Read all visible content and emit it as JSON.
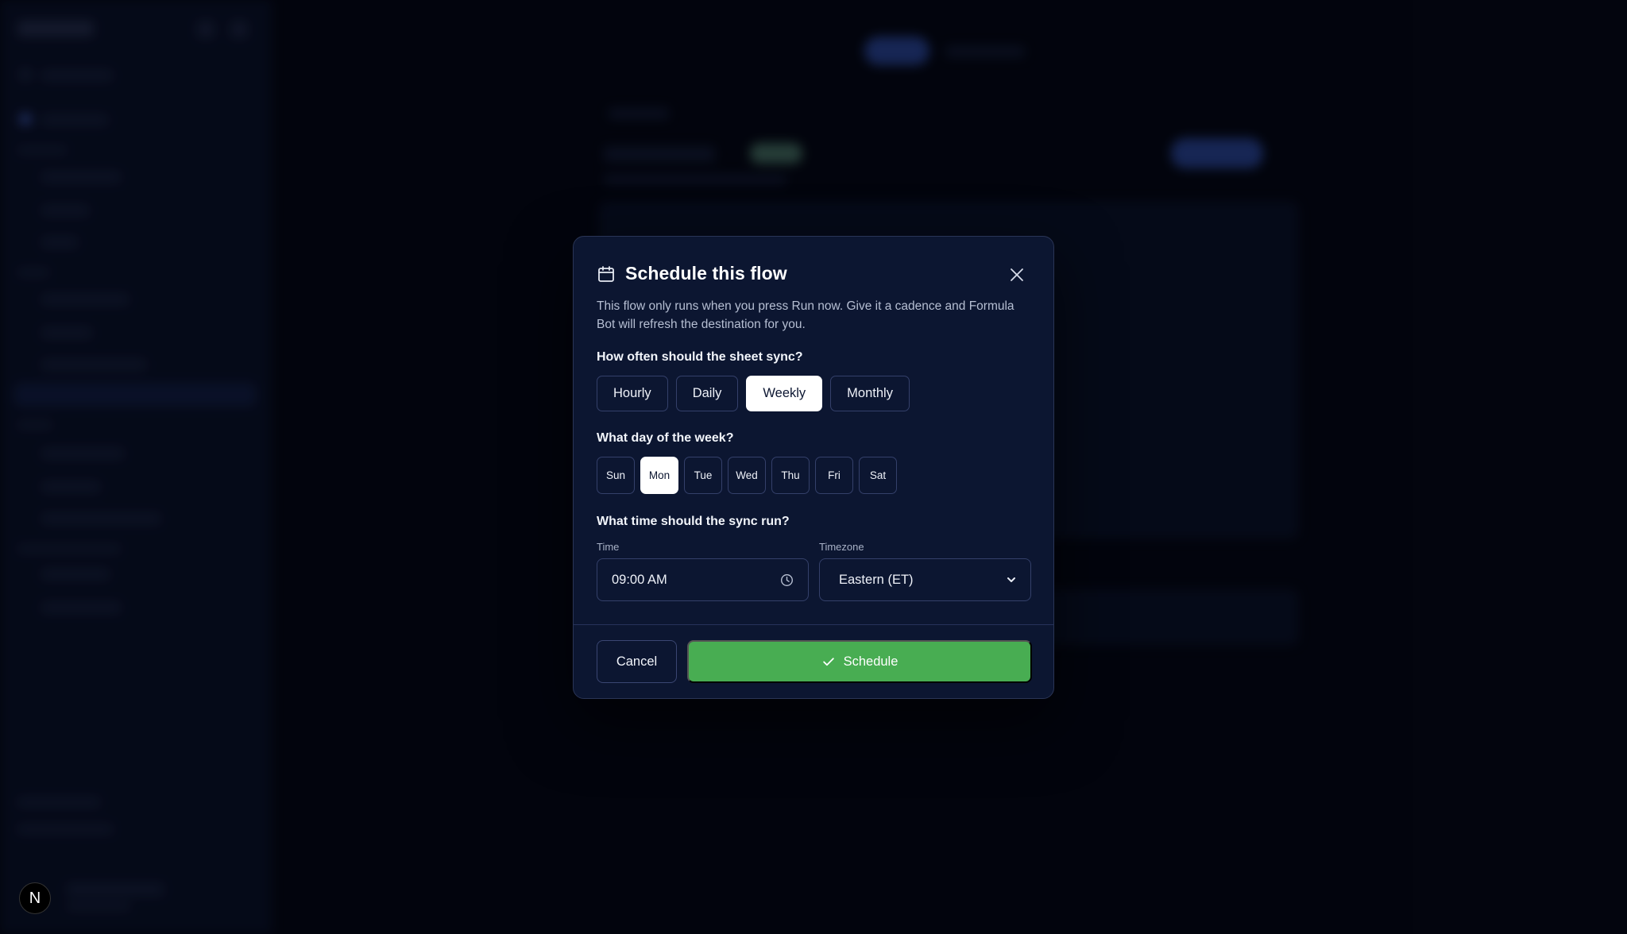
{
  "modal": {
    "title": "Schedule this flow",
    "description": "This flow only runs when you press Run now. Give it a cadence and Formula Bot will refresh the destination for you.",
    "frequency_question": "How often should the sheet sync?",
    "frequency_options": [
      "Hourly",
      "Daily",
      "Weekly",
      "Monthly"
    ],
    "frequency_selected": "Weekly",
    "day_question": "What day of the week?",
    "days": [
      "Sun",
      "Mon",
      "Tue",
      "Wed",
      "Thu",
      "Fri",
      "Sat"
    ],
    "day_selected": "Mon",
    "time_question": "What time should the sync run?",
    "time_label": "Time",
    "time_value": "09:00 AM",
    "timezone_label": "Timezone",
    "timezone_value": "Eastern (ET)",
    "cancel_label": "Cancel",
    "schedule_label": "Schedule"
  },
  "user": {
    "avatar_letter": "N"
  },
  "colors": {
    "modal_bg": "#0c1631",
    "accent_green": "#48ad52",
    "border": "#34406a",
    "selected_bg": "#ffffff"
  },
  "icons": [
    "calendar-icon",
    "close-icon",
    "clock-icon",
    "chevron-down-icon",
    "check-icon"
  ]
}
